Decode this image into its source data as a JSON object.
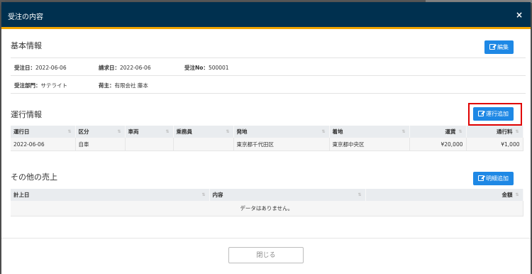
{
  "modal": {
    "title": "受注の内容",
    "close_glyph": "×"
  },
  "basic": {
    "title": "基本情報",
    "edit_label": "編集",
    "order_date_label": "受注日：",
    "order_date": "2022-06-06",
    "bill_date_label": "請求日：",
    "bill_date": "2022-06-06",
    "order_no_label": "受注No：",
    "order_no": "500001",
    "dept_label": "受注部門：",
    "dept": "サテライト",
    "shipper_label": "荷主：",
    "shipper": "有限会社 藤本"
  },
  "operation": {
    "title": "運行情報",
    "add_label": "運行追加",
    "columns": [
      "運行日",
      "区分",
      "車両",
      "乗務員",
      "発地",
      "着地",
      "運賃",
      "通行料"
    ],
    "rows": [
      [
        "2022-06-06",
        "自車",
        "",
        "",
        "東京都千代田区",
        "東京都中央区",
        "¥20,000",
        "¥1,000"
      ]
    ]
  },
  "other_sales": {
    "title": "その他の売上",
    "add_label": "明細追加",
    "columns": [
      "計上日",
      "内容",
      "金額"
    ],
    "empty_text": "データはありません。"
  },
  "footer": {
    "close_label": "閉じる"
  },
  "colors": {
    "header_bg": "#00304f",
    "header_accent": "#f0a400",
    "primary": "#1e88e5",
    "highlight": "#e00000"
  }
}
